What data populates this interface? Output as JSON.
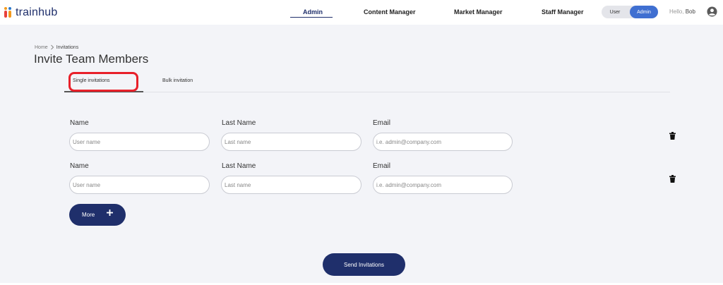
{
  "app": {
    "logo_text": "trainhub"
  },
  "nav": {
    "items": [
      {
        "label": "Admin",
        "active": true
      },
      {
        "label": "Content Manager",
        "active": false
      },
      {
        "label": "Market Manager",
        "active": false
      },
      {
        "label": "Staff Manager",
        "active": false
      }
    ]
  },
  "role_toggle": {
    "user_label": "User",
    "admin_label": "Admin",
    "selected": "Admin"
  },
  "user": {
    "greeting": "Hello,",
    "name": "Bob"
  },
  "breadcrumb": {
    "home": "Home",
    "current": "Invitations"
  },
  "page": {
    "title": "Invite Team Members"
  },
  "tabs": [
    {
      "label": "Single invitations",
      "active": true
    },
    {
      "label": "Bulk invitation",
      "active": false
    }
  ],
  "rows": [
    {
      "name_label": "Name",
      "name_placeholder": "User name",
      "name_value": "",
      "last_label": "Last Name",
      "last_placeholder": "Last name",
      "last_value": "",
      "email_label": "Email",
      "email_placeholder": "i.e. admin@company.com",
      "email_value": ""
    },
    {
      "name_label": "Name",
      "name_placeholder": "User name",
      "name_value": "",
      "last_label": "Last Name",
      "last_placeholder": "Last name",
      "last_value": "",
      "email_label": "Email",
      "email_placeholder": "i.e. admin@company.com",
      "email_value": ""
    }
  ],
  "buttons": {
    "more_label": "More",
    "send_label": "Send Invitations"
  },
  "colors": {
    "primary": "#1f2f6b",
    "toggle_active": "#3f6fd1",
    "highlight": "#e8202a",
    "background": "#f3f4f8"
  },
  "icons": {
    "avatar": "user-circle-icon",
    "delete": "trash-icon",
    "add": "plus-icon",
    "breadcrumb_separator": "chevron-right-icon"
  }
}
